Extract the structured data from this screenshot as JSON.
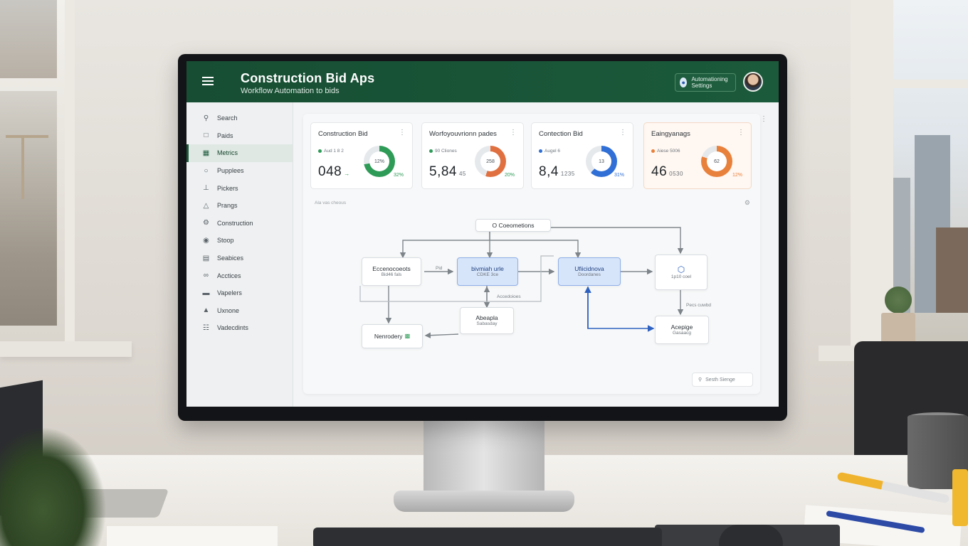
{
  "app": {
    "title": "Construction Bid Aps",
    "subtitle": "Workflow Automation to bids",
    "automation_badge": "Automationing Settings"
  },
  "sidebar": {
    "items": [
      {
        "label": "Search",
        "icon": "search-icon"
      },
      {
        "label": "Paids",
        "icon": "document-icon"
      },
      {
        "label": "Metrics",
        "icon": "chart-icon",
        "active": true
      },
      {
        "label": "Pupplees",
        "icon": "basket-icon"
      },
      {
        "label": "Pickers",
        "icon": "pin-icon"
      },
      {
        "label": "Prangs",
        "icon": "warning-icon"
      },
      {
        "label": "Construction",
        "icon": "gear-icon"
      },
      {
        "label": "Stoop",
        "icon": "globe-icon"
      },
      {
        "label": "Seabices",
        "icon": "clipboard-icon"
      },
      {
        "label": "Acctices",
        "icon": "share-icon"
      },
      {
        "label": "Vapelers",
        "icon": "list-icon"
      },
      {
        "label": "Uxnone",
        "icon": "cone-icon"
      },
      {
        "label": "Vadecdints",
        "icon": "grid-icon"
      }
    ]
  },
  "cards": [
    {
      "title": "Construction Bid",
      "sub": "Aud 1 8 2",
      "value": "048",
      "small": "",
      "center": "12%",
      "pct": "32%",
      "color": "#2e9b57",
      "pct_color": "#2e9b57",
      "fill": 0.72
    },
    {
      "title": "Worfoyouvrionn pades",
      "sub": "90 Cliones",
      "value": "5,84",
      "small": "45",
      "center": "258",
      "pct": "20%",
      "color": "#e07040",
      "pct_color": "#2e9b57",
      "fill": 0.55
    },
    {
      "title": "Contection Bid",
      "sub": "Augel 6",
      "value": "8,4",
      "small": "1235",
      "center": "13",
      "pct": "31%",
      "color": "#2f6fd6",
      "pct_color": "#2f6fd6",
      "fill": 0.62
    },
    {
      "title": "Eaingyanags",
      "sub": "Aiese 5006",
      "value": "46",
      "small": "0530",
      "center": "62",
      "pct": "12%",
      "color": "#e8813c",
      "pct_color": "#e8813c",
      "fill": 0.8
    }
  ],
  "section_hint": "Ala vas cheous",
  "diagram": {
    "nodes": {
      "top": "O Coeometions",
      "n1_title": "Eccenocoeots",
      "n1_sub": "Bid46 fals",
      "n2_title": "bivmiah urle",
      "n2_sub": "CDKE 3ce",
      "n3_title": "Ufiicidnova",
      "n3_sub": "Doordanes",
      "n4_sub": "1p10 coel",
      "n5_title": "Abeapla",
      "n5_sub": "Sabasday",
      "n6_title": "Nenrodery",
      "n7_title": "Acepige",
      "n7_sub": "Gasaacg"
    },
    "labels": {
      "edge_mid": "Accedoioes",
      "edge_right": "Pecs cuwbd",
      "edge_small": "Pid"
    }
  },
  "search_box": "Sesth Sienge"
}
